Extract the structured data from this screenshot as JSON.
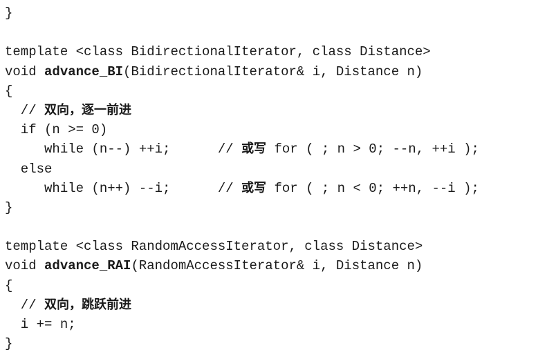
{
  "lines": [
    {
      "segments": [
        {
          "text": "}",
          "style": "plain"
        }
      ]
    },
    {
      "segments": []
    },
    {
      "segments": [
        {
          "text": "template <class BidirectionalIterator, class Distance>",
          "style": "plain"
        }
      ]
    },
    {
      "segments": [
        {
          "text": "void ",
          "style": "plain"
        },
        {
          "text": "advance_BI",
          "style": "bold"
        },
        {
          "text": "(BidirectionalIterator& i, Distance n)",
          "style": "plain"
        }
      ]
    },
    {
      "segments": [
        {
          "text": "{",
          "style": "plain"
        }
      ]
    },
    {
      "segments": [
        {
          "text": "  // ",
          "style": "plain"
        },
        {
          "text": "双向，逐一前进",
          "style": "cjk"
        }
      ]
    },
    {
      "segments": [
        {
          "text": "  if (n >= 0)",
          "style": "plain"
        }
      ]
    },
    {
      "segments": [
        {
          "text": "     while (n--) ++i;      // ",
          "style": "plain"
        },
        {
          "text": "或写",
          "style": "cjk"
        },
        {
          "text": " for ( ; n > 0; --n, ++i );",
          "style": "plain"
        }
      ]
    },
    {
      "segments": [
        {
          "text": "  else",
          "style": "plain"
        }
      ]
    },
    {
      "segments": [
        {
          "text": "     while (n++) --i;      // ",
          "style": "plain"
        },
        {
          "text": "或写",
          "style": "cjk"
        },
        {
          "text": " for ( ; n < 0; ++n, --i );",
          "style": "plain"
        }
      ]
    },
    {
      "segments": [
        {
          "text": "}",
          "style": "plain"
        }
      ]
    },
    {
      "segments": []
    },
    {
      "segments": [
        {
          "text": "template <class RandomAccessIterator, class Distance>",
          "style": "plain"
        }
      ]
    },
    {
      "segments": [
        {
          "text": "void ",
          "style": "plain"
        },
        {
          "text": "advance_RAI",
          "style": "bold"
        },
        {
          "text": "(RandomAccessIterator& i, Distance n)",
          "style": "plain"
        }
      ]
    },
    {
      "segments": [
        {
          "text": "{",
          "style": "plain"
        }
      ]
    },
    {
      "segments": [
        {
          "text": "  // ",
          "style": "plain"
        },
        {
          "text": "双向，跳跃前进",
          "style": "cjk"
        }
      ]
    },
    {
      "segments": [
        {
          "text": "  i += n;",
          "style": "plain"
        }
      ]
    },
    {
      "segments": [
        {
          "text": "}",
          "style": "plain"
        }
      ]
    }
  ]
}
